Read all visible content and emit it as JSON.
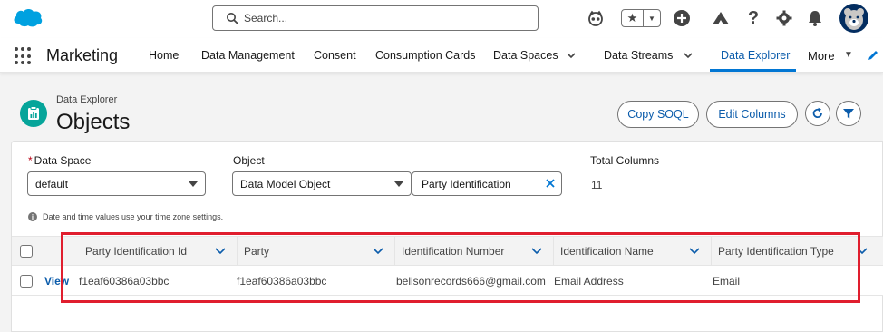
{
  "colors": {
    "brand": "#0176d3",
    "link": "#0b5cab",
    "highlight": "#e01e2e",
    "object_icon": "#06a59a"
  },
  "header": {
    "search_placeholder": "Search...",
    "icons": [
      "salesforce-cloud-icon",
      "einstein-icon",
      "favorites-star-icon",
      "add-icon",
      "trailhead-icon",
      "help-icon",
      "setup-gear-icon",
      "notifications-bell-icon",
      "avatar"
    ]
  },
  "nav": {
    "app_name": "Marketing",
    "items": [
      {
        "label": "Home"
      },
      {
        "label": "Data Management"
      },
      {
        "label": "Consent"
      },
      {
        "label": "Consumption Cards"
      },
      {
        "label": "Data Spaces"
      },
      {
        "label": "Data Streams"
      },
      {
        "label": "Data Explorer"
      },
      {
        "label": "More"
      }
    ],
    "active": "Data Explorer"
  },
  "page": {
    "breadcrumb": "Data Explorer",
    "title": "Objects",
    "copy_soql": "Copy SOQL",
    "edit_columns": "Edit Columns"
  },
  "filters": {
    "data_space_label": "Data Space",
    "data_space_required": "*",
    "data_space_value": "default",
    "object_label": "Object",
    "object_type_value": "Data Model Object",
    "object_value": "Party Identification",
    "total_columns_label": "Total Columns",
    "total_columns_value": "11",
    "note": "Date and time values use your time zone settings."
  },
  "table": {
    "columns": [
      "Party Identification Id",
      "Party",
      "Identification Number",
      "Identification Name",
      "Party Identification Type"
    ],
    "rows": [
      {
        "action": "View",
        "cells": [
          "f1eaf60386a03bbc",
          "f1eaf60386a03bbc",
          "bellsonrecords666@gmail.com",
          "Email Address",
          "Email"
        ]
      }
    ]
  }
}
